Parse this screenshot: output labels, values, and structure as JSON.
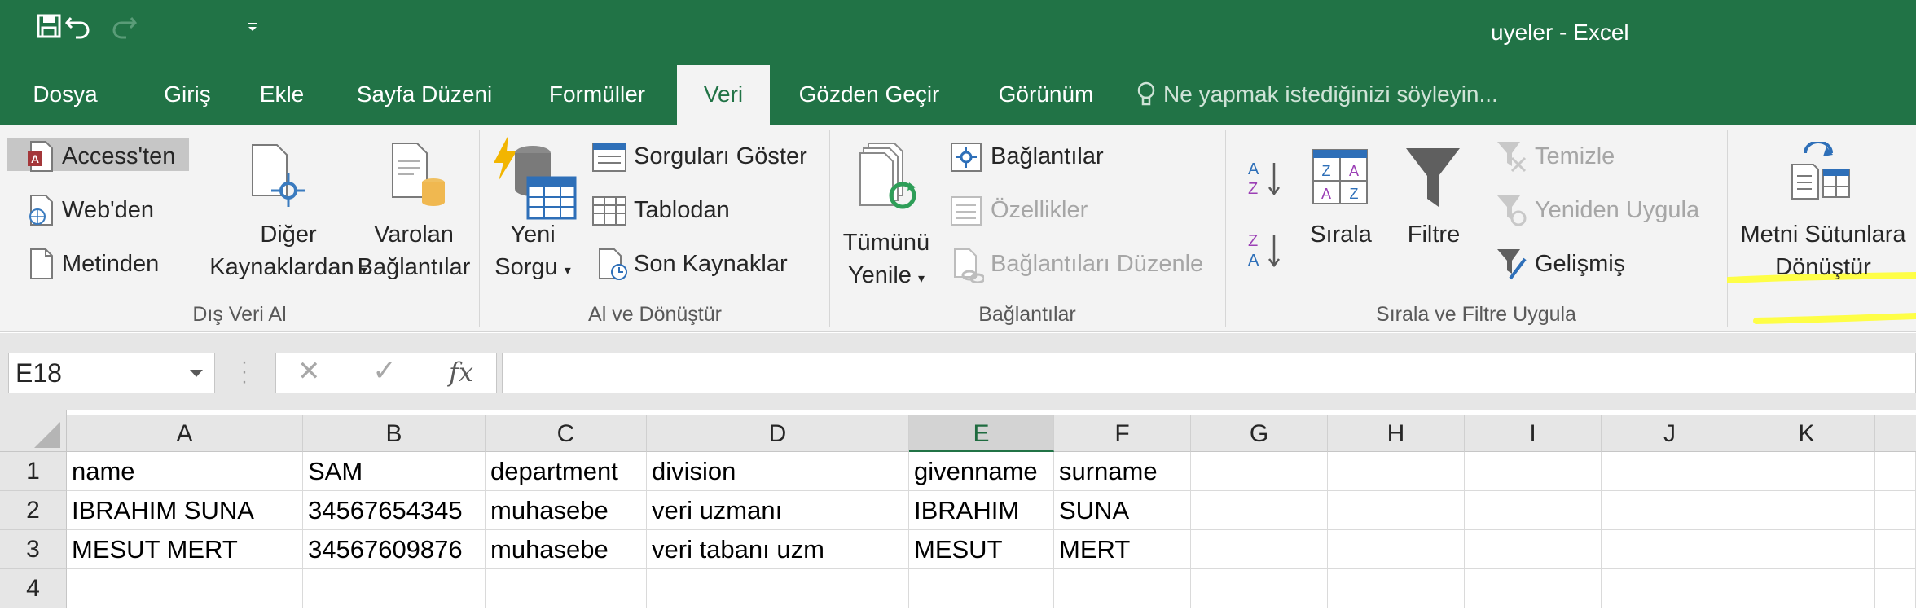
{
  "window": {
    "title": "uyeler - Excel"
  },
  "qat": {
    "save_icon": "save-icon",
    "undo_icon": "undo-icon",
    "redo_icon": "redo-icon",
    "customize_icon": "customize-qat-icon"
  },
  "tabs": [
    {
      "label": "Dosya"
    },
    {
      "label": "Giriş"
    },
    {
      "label": "Ekle"
    },
    {
      "label": "Sayfa Düzeni"
    },
    {
      "label": "Formüller"
    },
    {
      "label": "Veri"
    },
    {
      "label": "Gözden Geçir"
    },
    {
      "label": "Görünüm"
    }
  ],
  "active_tab": "Veri",
  "tellme": {
    "placeholder": "Ne yapmak istediğinizi söyleyin..."
  },
  "ribbon": {
    "dis_veri_al": {
      "label": "Dış Veri Al",
      "access": "Access'ten",
      "web": "Web'den",
      "metin": "Metinden",
      "diger_1": "Diğer",
      "diger_2": "Kaynaklardan",
      "varolan_1": "Varolan",
      "varolan_2": "Bağlantılar"
    },
    "al_donustur": {
      "label": "Al ve Dönüştür",
      "yeni_1": "Yeni",
      "yeni_2": "Sorgu",
      "sorgulari_goster": "Sorguları Göster",
      "tablodan": "Tablodan",
      "son_kaynaklar": "Son Kaynaklar"
    },
    "baglantilar": {
      "label": "Bağlantılar",
      "tumunu_1": "Tümünü",
      "tumunu_2": "Yenile",
      "baglantilar_btn": "Bağlantılar",
      "ozellikler": "Özellikler",
      "duzenle": "Bağlantıları Düzenle"
    },
    "sirala_filtre": {
      "label": "Sırala ve Filtre Uygula",
      "sirala": "Sırala",
      "filtre": "Filtre",
      "temizle": "Temizle",
      "yeniden": "Yeniden Uygula",
      "gelismis": "Gelişmiş"
    },
    "veri_araclari": {
      "metni_1": "Metni Sütunlara",
      "metni_2": "Dönüştür",
      "highlight_color": "#ffff33"
    }
  },
  "formula_bar": {
    "name_box": "E18",
    "cancel_glyph": "✕",
    "enter_glyph": "✓",
    "fx": "fx",
    "value": ""
  },
  "sheet": {
    "columns": [
      "A",
      "B",
      "C",
      "D",
      "E",
      "F",
      "G",
      "H",
      "I",
      "J",
      "K"
    ],
    "selected_column": "E",
    "rows": [
      {
        "num": "1",
        "cells": [
          "name",
          "SAM",
          "department",
          "division",
          "givenname",
          "surname",
          "",
          "",
          "",
          "",
          ""
        ]
      },
      {
        "num": "2",
        "cells": [
          "IBRAHIM SUNA",
          "34567654345",
          "muhasebe",
          "veri uzmanı",
          "IBRAHIM",
          "SUNA",
          "",
          "",
          "",
          "",
          ""
        ]
      },
      {
        "num": "3",
        "cells": [
          "MESUT MERT",
          "34567609876",
          "muhasebe",
          "veri tabanı uzm",
          "MESUT",
          "MERT",
          "",
          "",
          "",
          "",
          ""
        ]
      },
      {
        "num": "4",
        "cells": [
          "",
          "",
          "",
          "",
          "",
          "",
          "",
          "",
          "",
          "",
          ""
        ]
      }
    ]
  },
  "colors": {
    "excel_green": "#217346",
    "ribbon_bg": "#f3f3f3"
  }
}
